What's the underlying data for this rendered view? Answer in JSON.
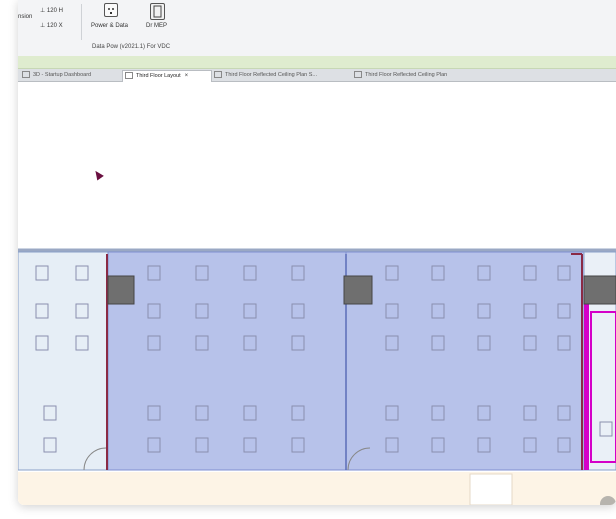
{
  "ribbon": {
    "small_items": [
      "120 H",
      "120 X",
      "nsion"
    ],
    "buttons": [
      {
        "label": "Power & Data",
        "icon": "power-data-icon"
      },
      {
        "label": "Dr MEP",
        "icon": "mep-icon"
      }
    ],
    "panel_caption": "Data Pow (v2021.1)   For VDC"
  },
  "tabs": [
    {
      "label": "3D - Startup Dashboard",
      "active": false
    },
    {
      "label": "Third Floor Layout",
      "active": true,
      "close": "×"
    },
    {
      "label": "Third Floor Reflected Ceiling Plan S...",
      "active": false
    },
    {
      "label": "Third Floor Reflected Ceiling Plan",
      "active": false
    }
  ],
  "colors": {
    "room_fill": "#b7c2ea",
    "room_fill_light": "#e6eef6",
    "wall": "#8a2a45",
    "column": "#6f6f6f",
    "magenta": "#d400c8",
    "corridor": "#fdf4e6"
  }
}
